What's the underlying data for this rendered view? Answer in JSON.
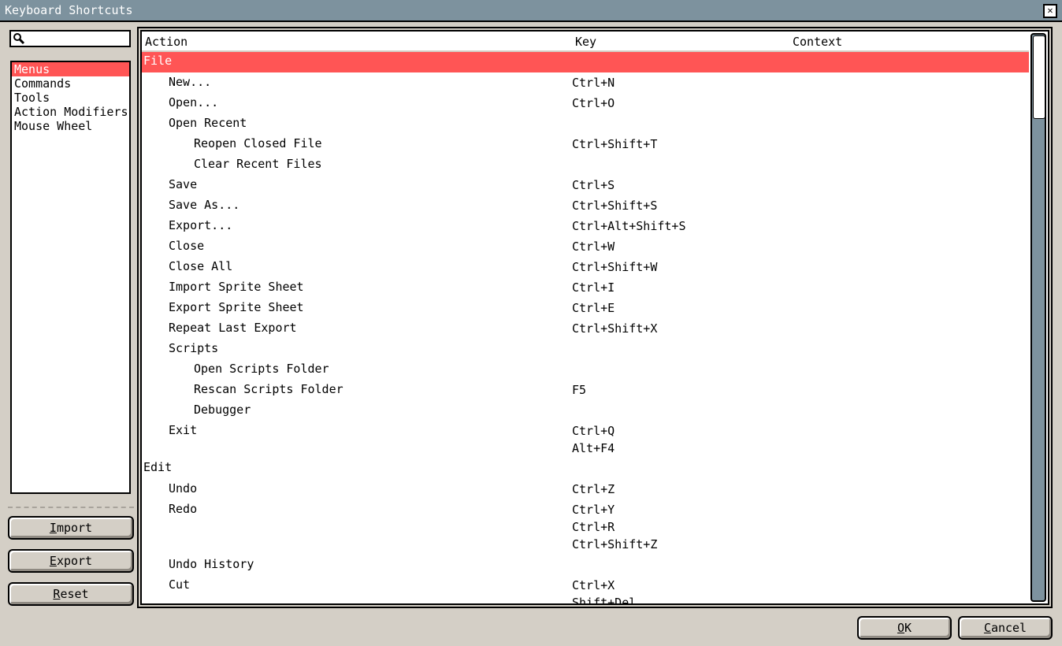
{
  "window": {
    "title": "Keyboard Shortcuts"
  },
  "search": {
    "value": "",
    "placeholder": ""
  },
  "categories": [
    "Menus",
    "Commands",
    "Tools",
    "Action Modifiers",
    "Mouse Wheel"
  ],
  "selected_category": 0,
  "buttons": {
    "import": {
      "mnemonic": "I",
      "rest": "mport"
    },
    "export": {
      "mnemonic": "E",
      "rest": "xport"
    },
    "reset": {
      "mnemonic": "R",
      "rest": "eset"
    },
    "ok": {
      "mnemonic": "O",
      "rest": "K"
    },
    "cancel": {
      "mnemonic": "C",
      "rest": "ancel"
    }
  },
  "table": {
    "columns": [
      "Action",
      "Key",
      "Context"
    ],
    "rows": [
      {
        "action": "File",
        "keys": [],
        "level": 0,
        "selected": true
      },
      {
        "action": "New...",
        "keys": [
          "Ctrl+N"
        ],
        "level": 1
      },
      {
        "action": "Open...",
        "keys": [
          "Ctrl+O"
        ],
        "level": 1
      },
      {
        "action": "Open Recent",
        "keys": [],
        "level": 1
      },
      {
        "action": "Reopen Closed File",
        "keys": [
          "Ctrl+Shift+T"
        ],
        "level": 2
      },
      {
        "action": "Clear Recent Files",
        "keys": [],
        "level": 2
      },
      {
        "action": "Save",
        "keys": [
          "Ctrl+S"
        ],
        "level": 1
      },
      {
        "action": "Save As...",
        "keys": [
          "Ctrl+Shift+S"
        ],
        "level": 1
      },
      {
        "action": "Export...",
        "keys": [
          "Ctrl+Alt+Shift+S"
        ],
        "level": 1
      },
      {
        "action": "Close",
        "keys": [
          "Ctrl+W"
        ],
        "level": 1
      },
      {
        "action": "Close All",
        "keys": [
          "Ctrl+Shift+W"
        ],
        "level": 1
      },
      {
        "action": "Import Sprite Sheet",
        "keys": [
          "Ctrl+I"
        ],
        "level": 1
      },
      {
        "action": "Export Sprite Sheet",
        "keys": [
          "Ctrl+E"
        ],
        "level": 1
      },
      {
        "action": "Repeat Last Export",
        "keys": [
          "Ctrl+Shift+X"
        ],
        "level": 1
      },
      {
        "action": "Scripts",
        "keys": [],
        "level": 1
      },
      {
        "action": "Open Scripts Folder",
        "keys": [],
        "level": 2
      },
      {
        "action": "Rescan Scripts Folder",
        "keys": [
          "F5"
        ],
        "level": 2
      },
      {
        "action": "Debugger",
        "keys": [],
        "level": 2
      },
      {
        "action": "Exit",
        "keys": [
          "Ctrl+Q",
          "Alt+F4"
        ],
        "level": 1
      },
      {
        "action": "Edit",
        "keys": [],
        "level": 0
      },
      {
        "action": "Undo",
        "keys": [
          "Ctrl+Z"
        ],
        "level": 1
      },
      {
        "action": "Redo",
        "keys": [
          "Ctrl+Y",
          "Ctrl+R",
          "Ctrl+Shift+Z"
        ],
        "level": 1
      },
      {
        "action": "Undo History",
        "keys": [],
        "level": 1
      },
      {
        "action": "Cut",
        "keys": [
          "Ctrl+X",
          "Shift+Del"
        ],
        "level": 1
      }
    ]
  },
  "colors": {
    "selection": "#ff5555",
    "titlebar": "#7d929e",
    "background": "#d4cfc6"
  },
  "icons": {
    "search": "magnifier-icon",
    "close": "close-icon"
  }
}
